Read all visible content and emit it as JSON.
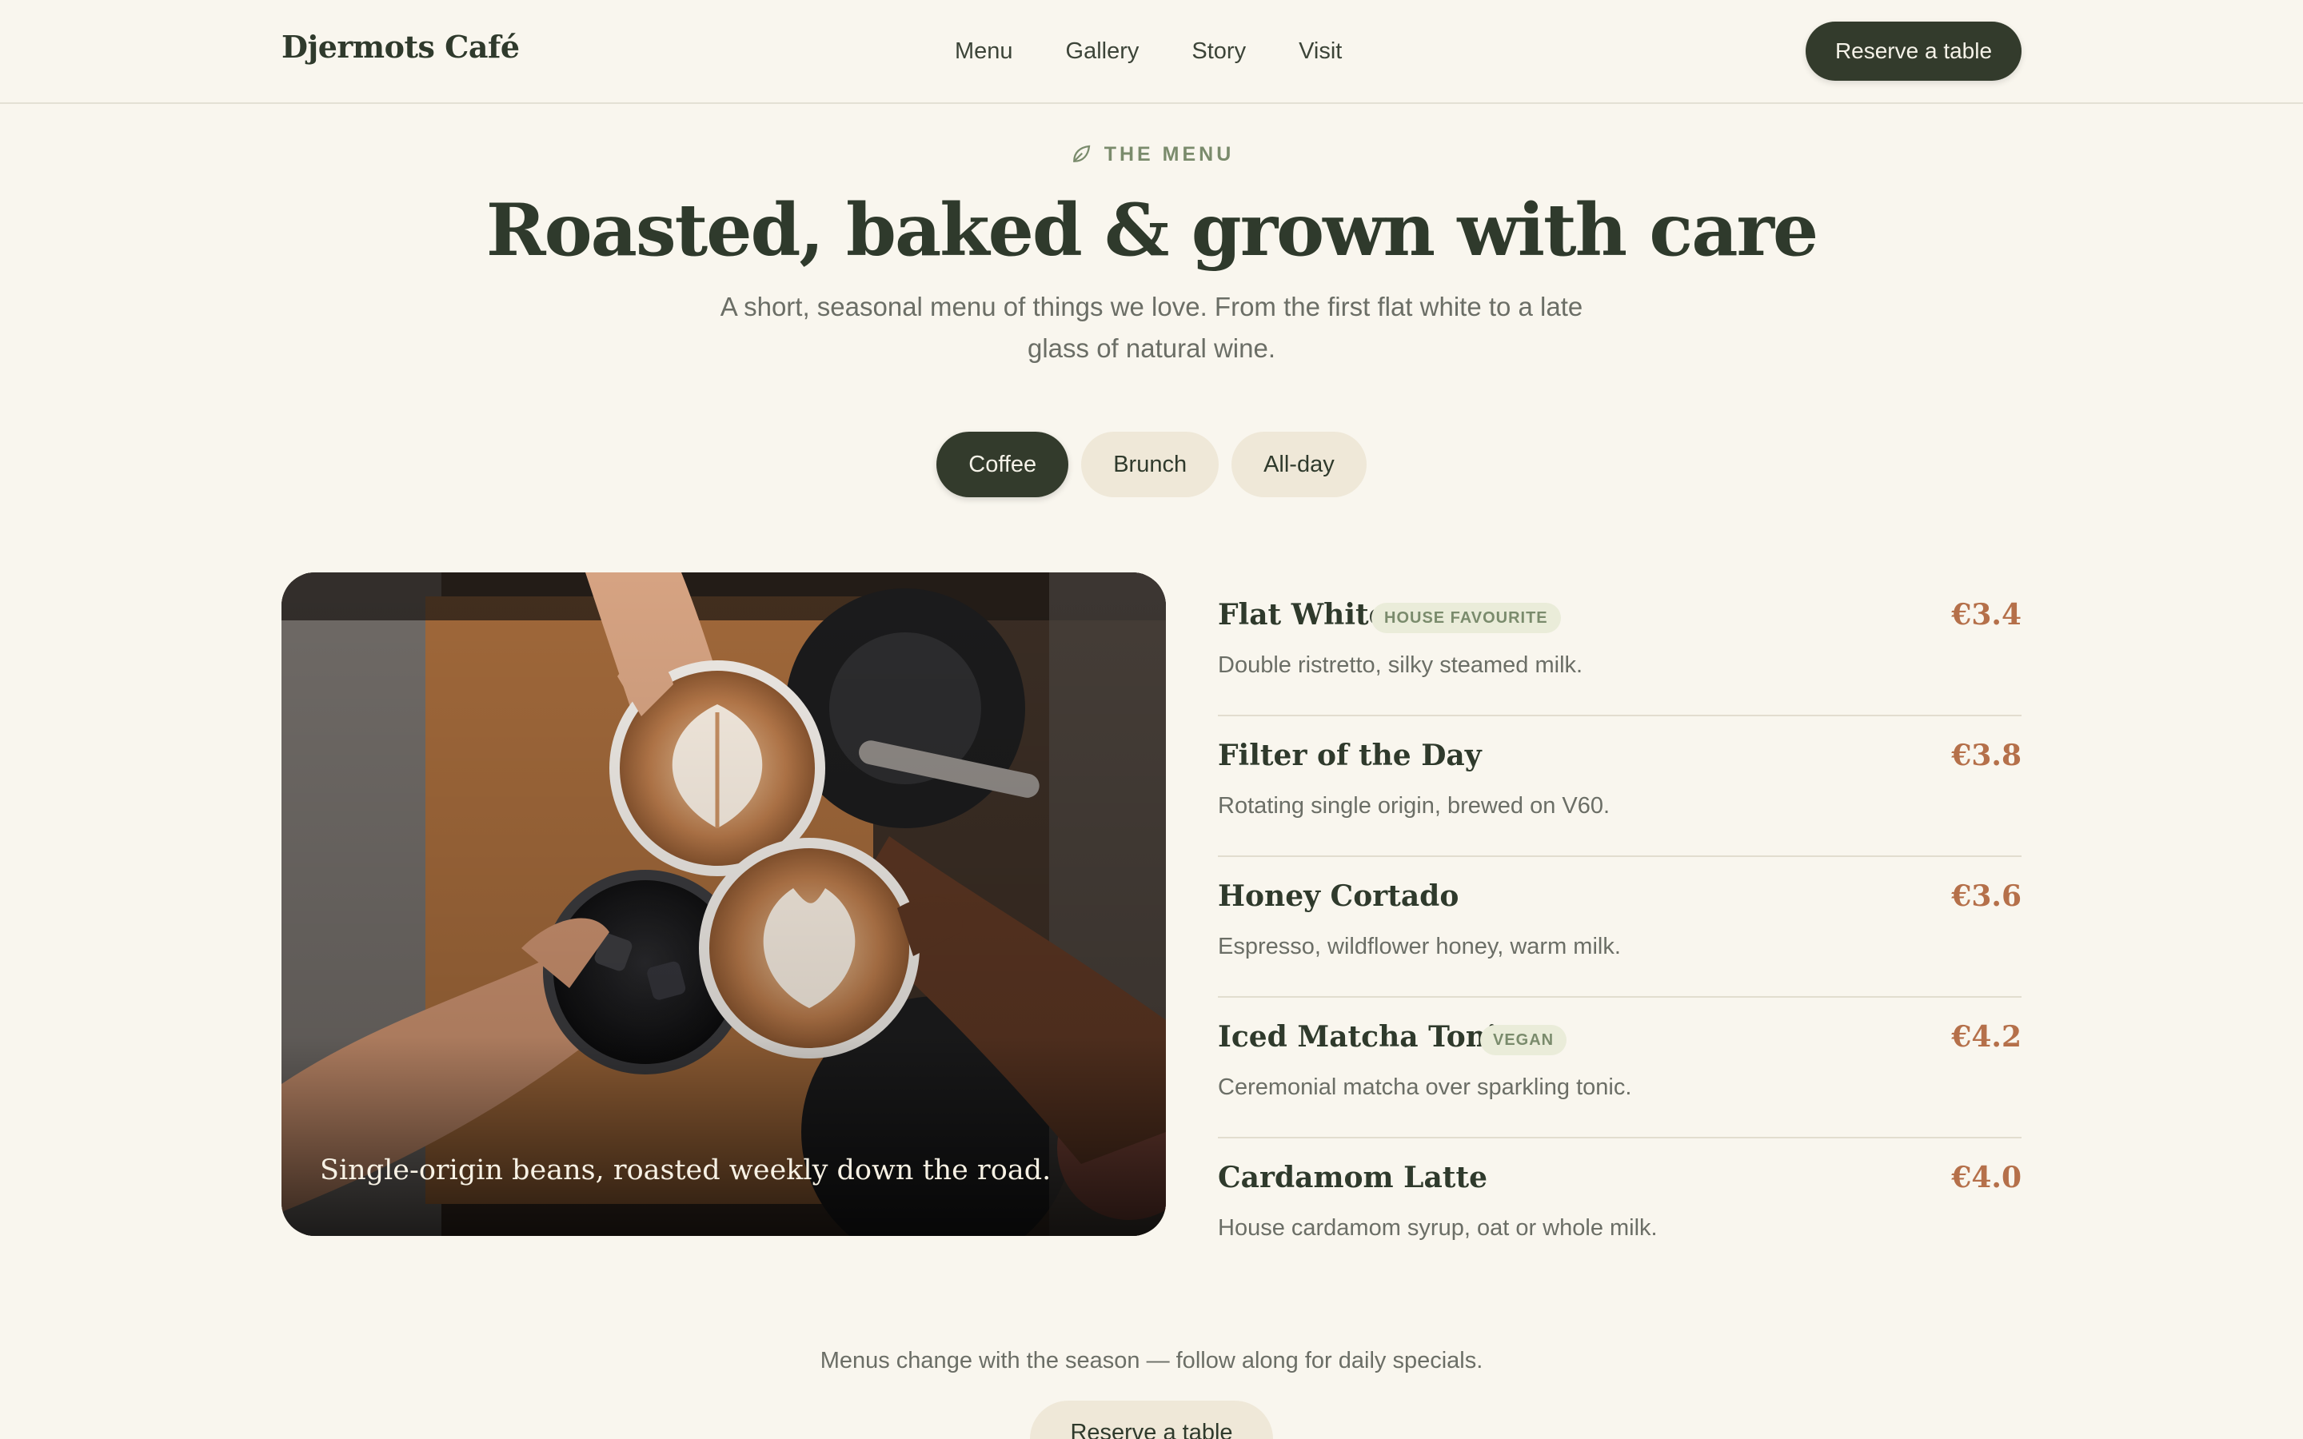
{
  "header": {
    "brand": "Djermots Café",
    "nav": [
      "Menu",
      "Gallery",
      "Story",
      "Visit"
    ],
    "cta": "Reserve a table"
  },
  "hero": {
    "eyebrow": "THE MENU",
    "eyebrow_icon": "leaf-icon",
    "title": "Roasted, baked & grown with care",
    "subtitle": "A short, seasonal menu of things we love. From the first flat white to a late glass of natural wine."
  },
  "tabs": [
    {
      "label": "Coffee",
      "active": true
    },
    {
      "label": "Brunch",
      "active": false
    },
    {
      "label": "All-day",
      "active": false
    }
  ],
  "photo": {
    "caption": "Single-origin beans, roasted weekly down the road."
  },
  "menu": {
    "items": [
      {
        "name": "Flat White",
        "badge": "HOUSE FAVOURITE",
        "price": "€3.4",
        "desc": "Double ristretto, silky steamed milk."
      },
      {
        "name": "Filter of the Day",
        "badge": "",
        "price": "€3.8",
        "desc": "Rotating single origin, brewed on V60."
      },
      {
        "name": "Honey Cortado",
        "badge": "",
        "price": "€3.6",
        "desc": "Espresso, wildflower honey, warm milk."
      },
      {
        "name": "Iced Matcha Tonic",
        "badge": "VEGAN",
        "price": "€4.2",
        "desc": "Ceremonial matcha over sparkling tonic."
      },
      {
        "name": "Cardamom Latte",
        "badge": "",
        "price": "€4.0",
        "desc": "House cardamom syrup, oat or whole milk."
      }
    ]
  },
  "footer": {
    "note": "Menus change with the season — follow along for daily specials.",
    "cta": "Reserve a table"
  },
  "colors": {
    "background": "#f9f6ee",
    "primary_dark": "#333b2c",
    "accent_price": "#b5704a",
    "accent_green": "#7a8b6c",
    "pill": "#efe8d8"
  }
}
